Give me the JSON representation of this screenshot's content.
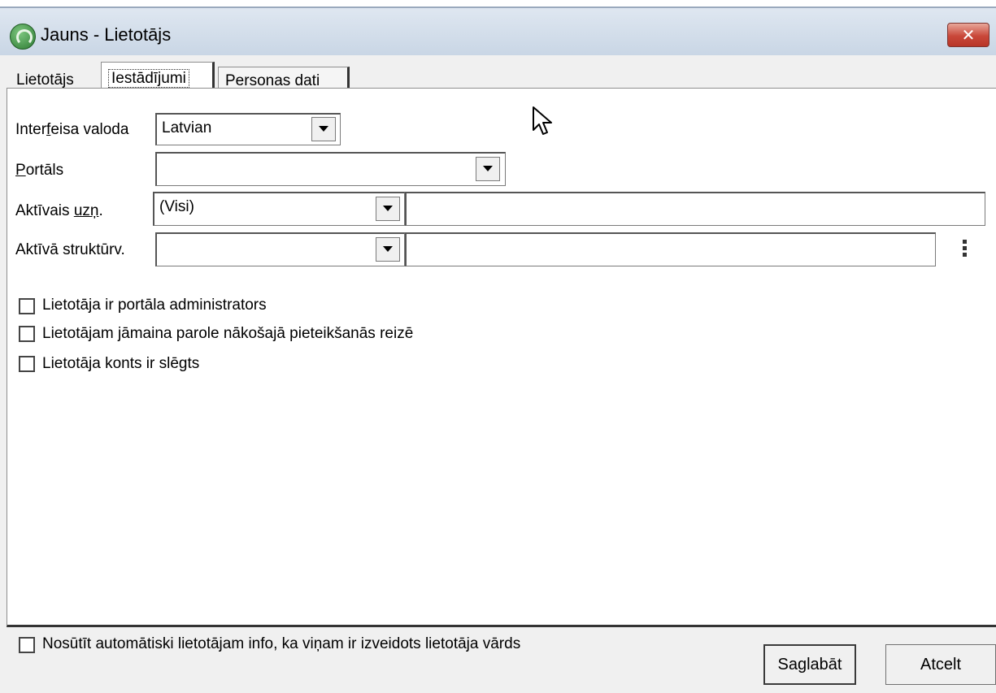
{
  "window": {
    "title": "Jauns - Lietotājs",
    "close_label": "✕"
  },
  "tabs": [
    {
      "label": "Lietotājs"
    },
    {
      "label": "Iestādījumi"
    },
    {
      "label": "Personas dati"
    }
  ],
  "form": {
    "language": {
      "label_pre": "Inter",
      "label_u": "f",
      "label_post": "eisa valoda",
      "value": "Latvian"
    },
    "portal": {
      "label_u": "P",
      "label_post": "ortāls",
      "value": ""
    },
    "company": {
      "label_pre": "Aktīvais ",
      "label_u": "uzņ",
      "label_post": ".",
      "value": "(Visi)",
      "extra": ""
    },
    "unit": {
      "label": "Aktīvā struktūrv.",
      "value": "",
      "extra": ""
    }
  },
  "checkboxes": [
    {
      "label": "Lietotāja ir portāla administrators",
      "checked": false
    },
    {
      "label": "Lietotājam jāmaina parole nākošajā pieteikšanās reizē",
      "checked": false
    },
    {
      "label": "Lietotāja konts ir slēgts",
      "checked": false
    }
  ],
  "footer": {
    "notify_label": "Nosūtīt automātiski lietotājam info, ka viņam ir izveidots lietotāja vārds",
    "notify_checked": false,
    "save_label": "Saglabāt",
    "cancel_label": "Atcelt"
  },
  "icons": {
    "app": "app-logo-icon",
    "close": "close-icon",
    "dropdown": "chevron-down-icon",
    "more": "more-vertical-icon",
    "cursor": "mouse-cursor-icon"
  },
  "colors": {
    "close_button": "#c9483a",
    "titlebar": "#c9d6e5",
    "panel_background": "#ffffff"
  }
}
